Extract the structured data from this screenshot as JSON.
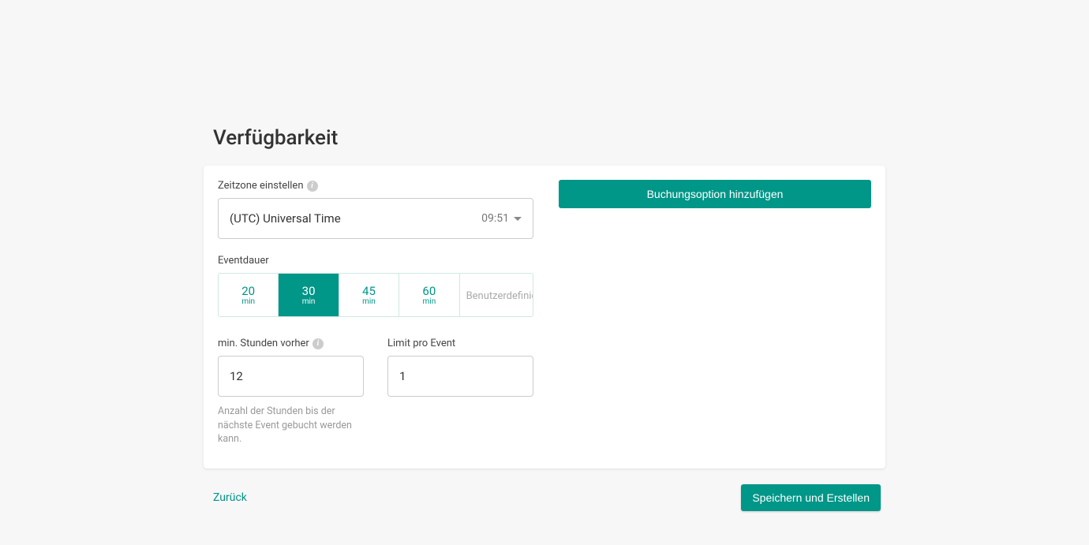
{
  "title": "Verfügbarkeit",
  "timezone": {
    "label": "Zeitzone einstellen",
    "value": "(UTC) Universal Time",
    "current_time": "09:51"
  },
  "duration": {
    "label": "Eventdauer",
    "unit": "min",
    "options": [
      "20",
      "30",
      "45",
      "60"
    ],
    "custom_label": "Benutzerdefiniert",
    "selected_index": 1
  },
  "min_hours": {
    "label": "min. Stunden vorher",
    "value": "12",
    "helper": "Anzahl der Stunden bis der nächste Event gebucht werden kann."
  },
  "limit": {
    "label": "Limit pro Event",
    "value": "1"
  },
  "add_option_label": "Buchungsoption hinzufügen",
  "footer": {
    "back": "Zurück",
    "save": "Speichern und Erstellen"
  }
}
